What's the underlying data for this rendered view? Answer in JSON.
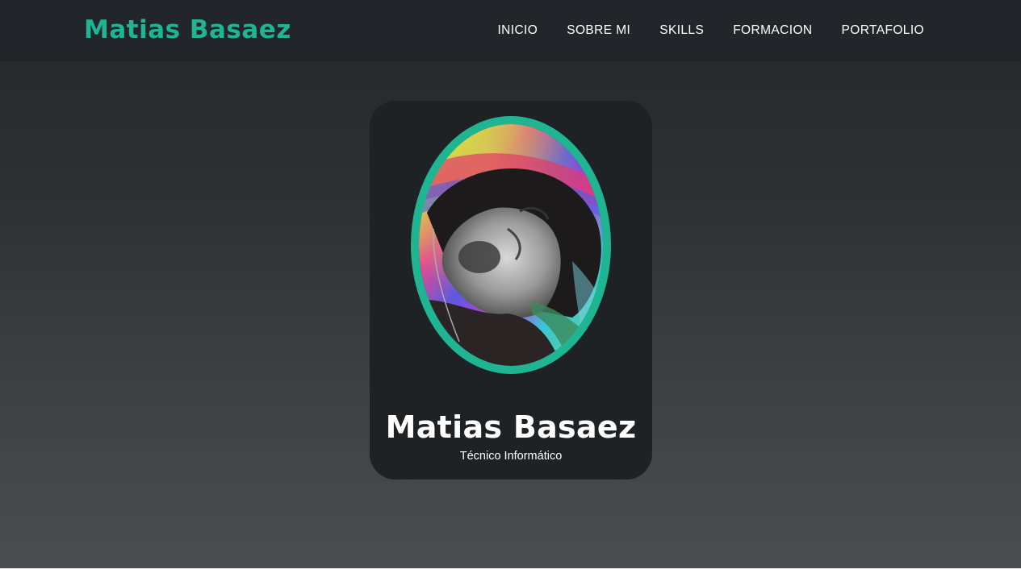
{
  "header": {
    "brand": "Matias Basaez",
    "nav": [
      {
        "label": "INICIO"
      },
      {
        "label": "SOBRE MI"
      },
      {
        "label": "SKILLS"
      },
      {
        "label": "FORMACION"
      },
      {
        "label": "PORTAFOLIO"
      }
    ]
  },
  "profile": {
    "name": "Matias Basaez",
    "role": "Técnico Informático",
    "photo_alt": "profile-photo"
  },
  "colors": {
    "accent": "#1fb592",
    "navbar_bg": "#22262a",
    "card_bg": "#1f2225",
    "text": "#ffffff"
  }
}
